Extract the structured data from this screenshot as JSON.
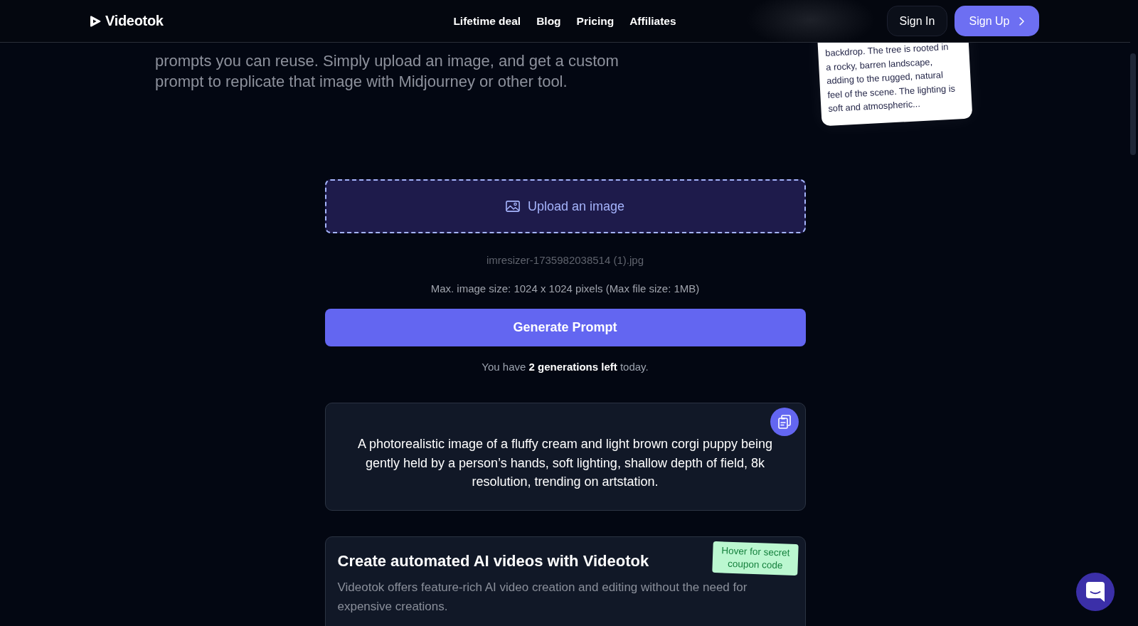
{
  "nav": {
    "logo": "Videotok",
    "links": [
      {
        "label": "Lifetime deal"
      },
      {
        "label": "Blog"
      },
      {
        "label": "Pricing"
      },
      {
        "label": "Affiliates"
      }
    ],
    "sign_in": "Sign In",
    "sign_up": "Sign Up"
  },
  "hero": {
    "description": "prompts you can reuse. Simply upload an image, and get a custom prompt to replicate that image with Midjourney or other tool."
  },
  "example_card": {
    "lines": [
      "backdrop. The tree is rooted in",
      "a rocky, barren landscape,",
      "adding to the rugged, natural",
      "feel of the scene. The lighting is",
      "soft and atmospheric..."
    ]
  },
  "upload": {
    "label": "Upload an image",
    "file_name": "imresizer-1735982038514 (1).jpg",
    "limits": "Max. image size: 1024 x 1024 pixels (Max file size: 1MB)"
  },
  "generate_button": "Generate Prompt",
  "quota_note": "You have **2 generations left** today.",
  "result": {
    "prompt": "A photorealistic image of a fluffy cream and light brown corgi puppy being gently held by a person’s hands, soft lighting, shallow depth of field, 8k resolution, trending on artstation."
  },
  "promo": {
    "title": "Create automated AI videos with Videotok",
    "description": "Videotok offers feature-rich AI video creation and editing without the need for expensive creations.",
    "badge": "Hover for secret coupon code"
  }
}
